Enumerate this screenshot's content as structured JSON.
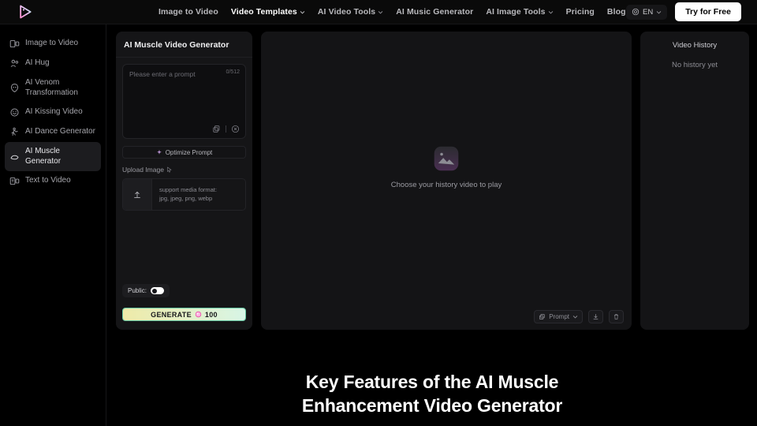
{
  "header": {
    "logo_name": "play-triangle-logo",
    "nav": [
      {
        "label": "Image to Video",
        "has_caret": false,
        "active": false
      },
      {
        "label": "Video Templates",
        "has_caret": true,
        "active": true
      },
      {
        "label": "AI Video Tools",
        "has_caret": true,
        "active": false
      },
      {
        "label": "AI Music Generator",
        "has_caret": false,
        "active": false
      },
      {
        "label": "AI Image Tools",
        "has_caret": true,
        "active": false
      },
      {
        "label": "Pricing",
        "has_caret": false,
        "active": false
      },
      {
        "label": "Blog",
        "has_caret": false,
        "active": false
      }
    ],
    "language": "EN",
    "cta": "Try for Free"
  },
  "sidebar": {
    "items": [
      {
        "label": "Image to Video",
        "icon": "image-video-icon",
        "active": false
      },
      {
        "label": "AI Hug",
        "icon": "hug-icon",
        "active": false
      },
      {
        "label": "AI Venom\nTransformation",
        "icon": "venom-icon",
        "active": false
      },
      {
        "label": "AI Kissing Video",
        "icon": "kissing-icon",
        "active": false
      },
      {
        "label": "AI Dance Generator",
        "icon": "dance-icon",
        "active": false
      },
      {
        "label": "AI Muscle Generator",
        "icon": "muscle-icon",
        "active": true
      },
      {
        "label": "Text to Video",
        "icon": "text-video-icon",
        "active": false
      }
    ]
  },
  "generator": {
    "title": "AI Muscle Video Generator",
    "prompt_placeholder": "Please enter a prompt",
    "prompt_value": "",
    "char_counter": "0/512",
    "optimize_label": "Optimize Prompt",
    "upload_label": "Upload Image",
    "upload_hint_line1": "support media format:",
    "upload_hint_line2": "jpg, jpeg, png, webp",
    "public_label": "Public:",
    "public_enabled": false,
    "generate_label": "GENERATE",
    "generate_cost": "100"
  },
  "player": {
    "empty_text": "Choose your history video to play",
    "prompt_button": "Prompt",
    "toolbar": {
      "copy": "copy-icon",
      "download": "download-icon",
      "delete": "trash-icon"
    }
  },
  "history": {
    "title": "Video History",
    "empty": "No history yet"
  },
  "hero": {
    "line1": "Key Features of the AI Muscle",
    "line2": "Enhancement Video Generator"
  },
  "colors": {
    "page_bg": "#000000",
    "card_bg": "#151517",
    "accent_gradient_start": "#eeeaa8",
    "accent_gradient_end": "#d7f5e6",
    "logo_pink": "#ff9ad5",
    "logo_cyan": "#9ff0e4"
  }
}
